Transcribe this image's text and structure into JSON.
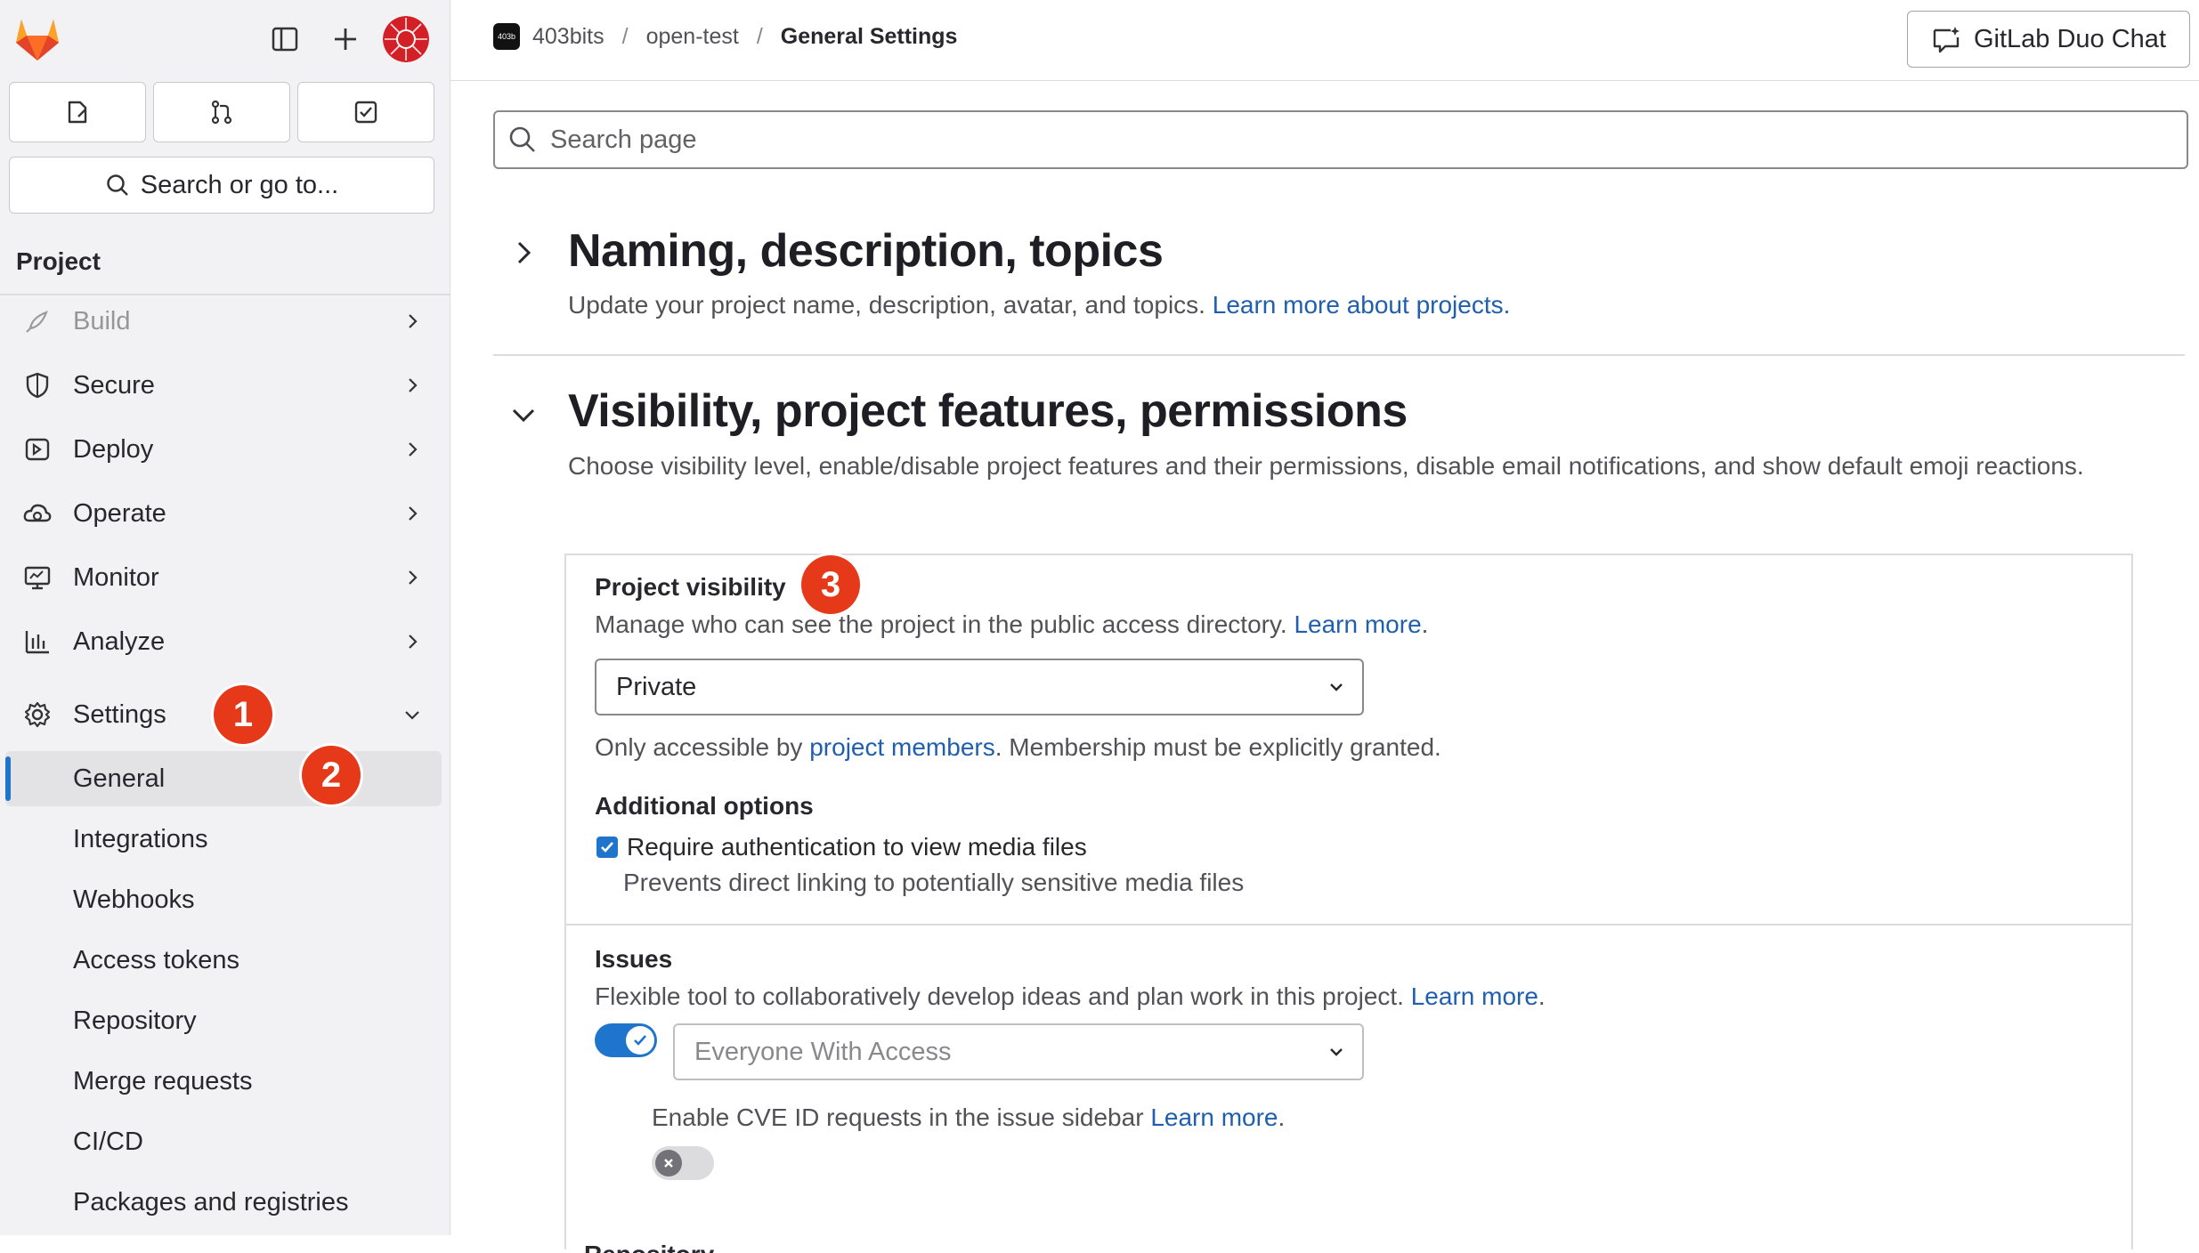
{
  "sidebar": {
    "search_label": "Search or go to...",
    "section_title": "Project",
    "nav": [
      {
        "label": "Build",
        "icon": "rocket-icon"
      },
      {
        "label": "Secure",
        "icon": "shield-icon"
      },
      {
        "label": "Deploy",
        "icon": "deploy-icon"
      },
      {
        "label": "Operate",
        "icon": "cloud-gear-icon"
      },
      {
        "label": "Monitor",
        "icon": "monitor-icon"
      },
      {
        "label": "Analyze",
        "icon": "chart-icon"
      },
      {
        "label": "Settings",
        "icon": "gear-icon"
      }
    ],
    "settings_sub": [
      {
        "label": "General"
      },
      {
        "label": "Integrations"
      },
      {
        "label": "Webhooks"
      },
      {
        "label": "Access tokens"
      },
      {
        "label": "Repository"
      },
      {
        "label": "Merge requests"
      },
      {
        "label": "CI/CD"
      },
      {
        "label": "Packages and registries"
      }
    ]
  },
  "badges": {
    "one": "1",
    "two": "2",
    "three": "3"
  },
  "header": {
    "group_avatar_text": "403b",
    "breadcrumbs": [
      "403bits",
      "open-test",
      "General Settings"
    ],
    "separator": "/",
    "duo_chat_label": "GitLab Duo Chat"
  },
  "main": {
    "search_placeholder": "Search page",
    "naming": {
      "title": "Naming, description, topics",
      "desc": "Update your project name, description, avatar, and topics.",
      "link": "Learn more about projects."
    },
    "visibility": {
      "title": "Visibility, project features, permissions",
      "desc": "Choose visibility level, enable/disable project features and their permissions, disable email notifications, and show default emoji reactions."
    },
    "project_visibility": {
      "label": "Project visibility",
      "help": "Manage who can see the project in the public access directory.",
      "help_link": "Learn more",
      "help_end": ".",
      "selected": "Private",
      "note_pre": "Only accessible by",
      "note_link": "project members",
      "note_post": ". Membership must be explicitly granted."
    },
    "additional": {
      "label": "Additional options",
      "checkbox_label": "Require authentication to view media files",
      "checkbox_checked": true,
      "checkbox_help": "Prevents direct linking to potentially sensitive media files"
    },
    "issues": {
      "label": "Issues",
      "help": "Flexible tool to collaboratively develop ideas and plan work in this project.",
      "help_link": "Learn more",
      "help_end": ".",
      "toggle_on": true,
      "access_level": "Everyone With Access",
      "cve_text": "Enable CVE ID requests in the issue sidebar",
      "cve_link": "Learn more",
      "cve_end": ".",
      "cve_toggle_on": false
    },
    "next_label_cut": "Repository"
  },
  "colors": {
    "accent": "#1f75cb",
    "badge": "#e5391a",
    "link": "#1f5fae"
  }
}
